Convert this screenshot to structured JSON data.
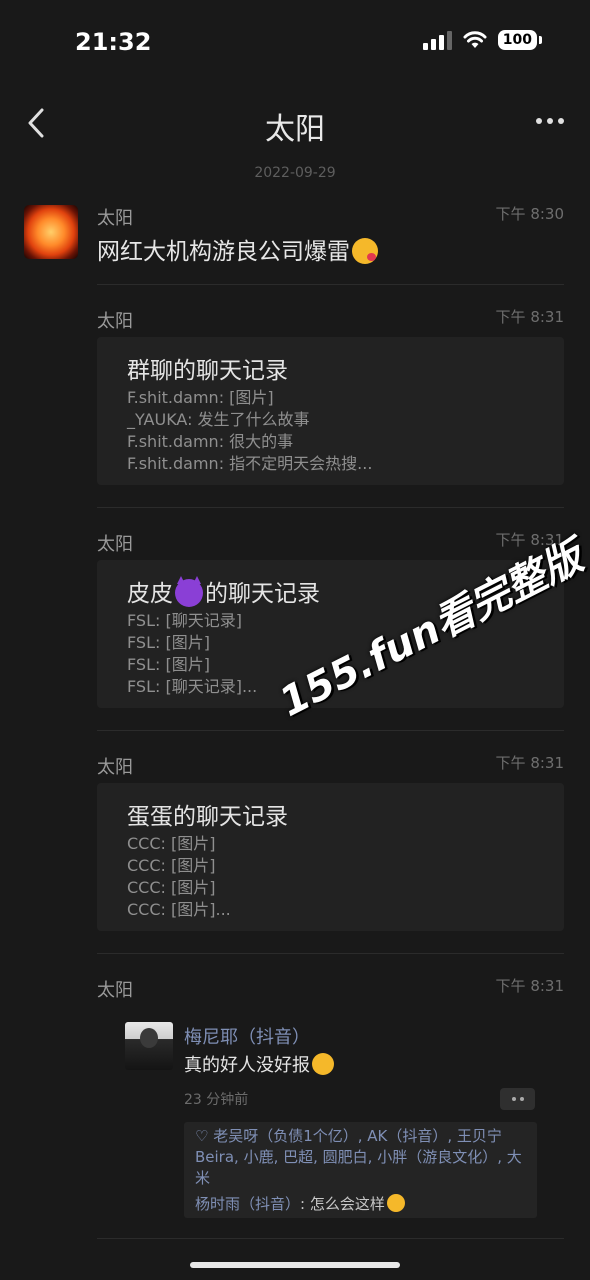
{
  "status_bar": {
    "time": "21:32",
    "battery": "100"
  },
  "nav": {
    "title": "太阳"
  },
  "date": "2022-09-29",
  "messages": [
    {
      "name": "太阳",
      "time": "下午 8:30",
      "text": "网红大机构游良公司爆雷"
    },
    {
      "name": "太阳",
      "time": "下午 8:31",
      "card": {
        "title": "群聊的聊天记录",
        "lines": [
          "F.shit.damn: [图片]",
          "_YAUKA: 发生了什么故事",
          "F.shit.damn: 很大的事",
          "F.shit.damn: 指不定明天会热搜..."
        ]
      }
    },
    {
      "name": "太阳",
      "time": "下午 8:31",
      "card": {
        "title_before": "皮皮",
        "title_after": "的聊天记录",
        "lines": [
          "FSL: [聊天记录]",
          "FSL: [图片]",
          "FSL: [图片]",
          "FSL: [聊天记录]..."
        ]
      }
    },
    {
      "name": "太阳",
      "time": "下午 8:31",
      "card": {
        "title": "蛋蛋的聊天记录",
        "lines": [
          "CCC: [图片]",
          "CCC: [图片]",
          "CCC: [图片]",
          "CCC: [图片]..."
        ]
      }
    },
    {
      "name": "太阳",
      "time": "下午 8:31",
      "moment": {
        "author": "梅尼耶（抖音）",
        "text": "真的好人没好报",
        "ago": "23 分钟前",
        "likes": "♡ 老吴呀（负债1个亿）, AK（抖音）, 王贝宁 Beira, 小鹿, 巴超, 圆肥白, 小胖（游良文化）, 大米",
        "comment_author": "杨时雨（抖音）",
        "comment_text": ": 怎么会这样"
      }
    }
  ],
  "watermark": "155.fun看完整版"
}
